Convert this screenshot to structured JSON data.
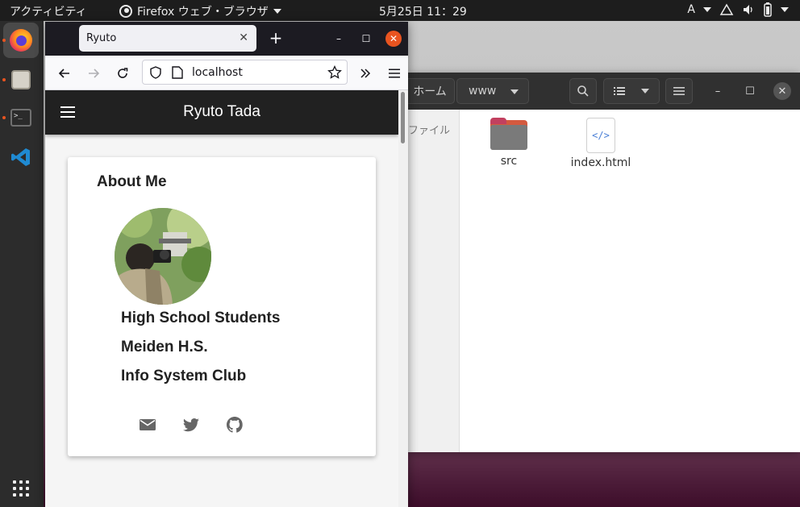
{
  "topbar": {
    "activities": "アクティビティ",
    "app_name": "Firefox ウェブ・ブラウザ",
    "clock": "5月25日  11：29",
    "input_method": "A"
  },
  "dock": {
    "items": [
      {
        "name": "firefox",
        "running": true
      },
      {
        "name": "files",
        "running": true
      },
      {
        "name": "terminal",
        "running": true
      },
      {
        "name": "vscode",
        "running": false
      }
    ]
  },
  "files_window": {
    "breadcrumb_home": "ホーム",
    "breadcrumb_current": "www",
    "sidebar_label": "ファイル",
    "items": [
      {
        "name": "src",
        "type": "folder"
      },
      {
        "name": "index.html",
        "type": "html"
      }
    ]
  },
  "browser": {
    "tab_title": "Ryuto",
    "url": "localhost"
  },
  "page": {
    "header_title": "Ryuto Tada",
    "about_heading": "About Me",
    "bio": [
      "High School Students",
      "Meiden H.S.",
      "Info System Club"
    ],
    "social_icons": [
      "email-icon",
      "twitter-icon",
      "github-icon"
    ]
  },
  "colors": {
    "accent_orange": "#e95420",
    "header_dark": "#212121",
    "topbar": "#1d1d1d"
  }
}
